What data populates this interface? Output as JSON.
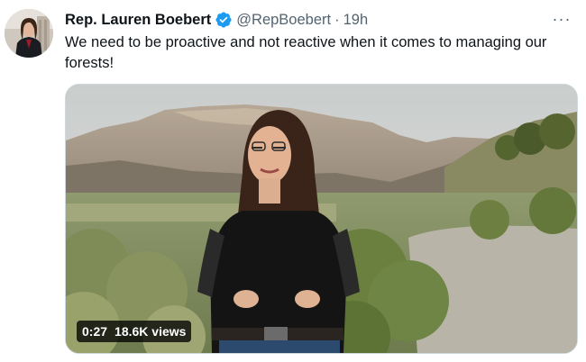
{
  "author": {
    "name": "Rep. Lauren Boebert",
    "handle": "@RepBoebert",
    "separator": "·",
    "time": "19h",
    "verified_icon": "verified-badge-icon",
    "verified_color": "#1d9bf0"
  },
  "tweet": {
    "text": "We need to be proactive and not reactive when it comes to managing our forests!"
  },
  "more_menu": {
    "label": "···"
  },
  "video": {
    "duration": "0:27",
    "views": "18.6K views"
  },
  "colors": {
    "text_primary": "#0f1419",
    "text_secondary": "#536471",
    "border": "#cfd9de"
  }
}
